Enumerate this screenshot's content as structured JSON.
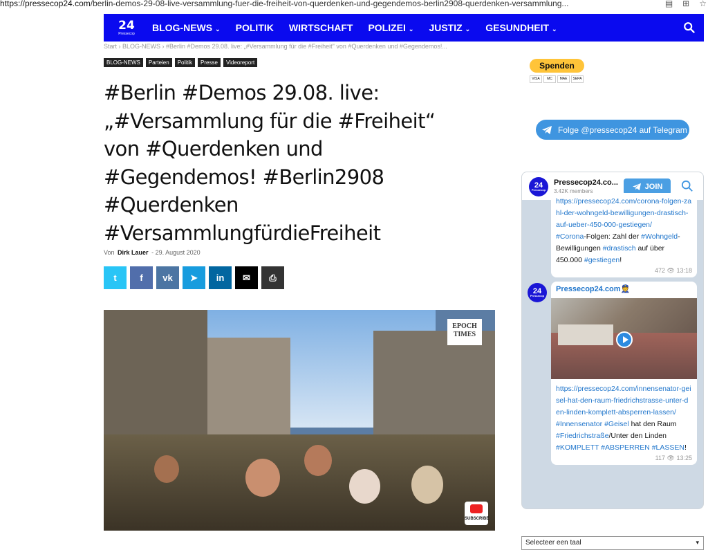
{
  "browser": {
    "url_host": "https://pressecop24.com",
    "url_path": "/berlin-demos-29-08-live-versammlung-fuer-die-freiheit-von-querdenken-und-gegendemos-berlin2908-querdenken-versammlung..."
  },
  "nav": {
    "logo_number": "24",
    "logo_sub": "Pressecop",
    "items": [
      {
        "label": "BLOG-NEWS",
        "dropdown": true
      },
      {
        "label": "POLITIK",
        "dropdown": false
      },
      {
        "label": "WIRTSCHAFT",
        "dropdown": false
      },
      {
        "label": "POLIZEI",
        "dropdown": true
      },
      {
        "label": "JUSTIZ",
        "dropdown": true
      },
      {
        "label": "GESUNDHEIT",
        "dropdown": true
      }
    ],
    "bg_color": "#0a0aef"
  },
  "breadcrumb": "Start  ›  BLOG-NEWS  ›  #Berlin #Demos 29.08. live: „#Versammlung für die #Freiheit\" von #Querdenken und #Gegendemos!...",
  "tags": [
    "BLOG-NEWS",
    "Parteien",
    "Politik",
    "Presse",
    "Videoreport"
  ],
  "article": {
    "title": "#Berlin #Demos 29.08. live: „#Versammlung für die #Freiheit“ von #Querdenken und #Gegendemos! #Berlin2908 #Querdenken #VersammlungfürdieFreiheit",
    "by": "Von",
    "author": "Dirk Lauer",
    "date": "29. August 2020",
    "photo_watermark": "EPOCH TIMES",
    "youtube_label": "SUBSCRIBE"
  },
  "share_buttons": [
    {
      "icon": "twitter-icon",
      "glyph": "t",
      "color": "#29c5f6"
    },
    {
      "icon": "facebook-icon",
      "glyph": "f",
      "color": "#516eab"
    },
    {
      "icon": "vk-icon",
      "glyph": "vk",
      "color": "#4c75a3"
    },
    {
      "icon": "telegram-icon",
      "glyph": "➤",
      "color": "#179cde"
    },
    {
      "icon": "linkedin-icon",
      "glyph": "in",
      "color": "#0266a0"
    },
    {
      "icon": "email-icon",
      "glyph": "✉",
      "color": "#000000"
    },
    {
      "icon": "print-icon",
      "glyph": "⎙",
      "color": "#333333"
    }
  ],
  "sidebar": {
    "donate_label": "Spenden",
    "card_labels": [
      "VISA",
      "MC",
      "MAE",
      "SEPA"
    ],
    "telegram_follow": "Folge @pressecop24 auf Telegram"
  },
  "telegram_widget": {
    "channel_name": "Pressecop24.co...",
    "members": "3.42K members",
    "join_label": "JOIN",
    "msg1": {
      "link": "https://pressecop24.com/corona-folgen-zahl-der-wohngeld-bewilligungen-drastisch-auf-ueber-450-000-gestiegen/",
      "text_parts": [
        "#Corona",
        "-Folgen: Zahl der ",
        "#Wohngeld",
        "-Bewilligungen ",
        "#drastisch",
        " auf über 450.000 ",
        "#gestiegen",
        "!"
      ],
      "views": "472",
      "time": "13:18"
    },
    "msg2": {
      "author": "Pressecop24.com👮",
      "link": "https://pressecop24.com/innensenator-geisel-hat-den-raum-friedrichstrasse-unter-den-linden-komplett-absperren-lassen/",
      "text_parts": [
        "#Innensenator",
        " ",
        "#Geisel",
        " hat den Raum ",
        "#Friedrichstraße",
        "/Unter den Linden ",
        "#KOMPLETT",
        " ",
        "#ABSPERREN",
        " ",
        "#LASSEN",
        "!"
      ],
      "views": "117",
      "time": "13:25"
    }
  },
  "language_select": "Selecteer een taal"
}
